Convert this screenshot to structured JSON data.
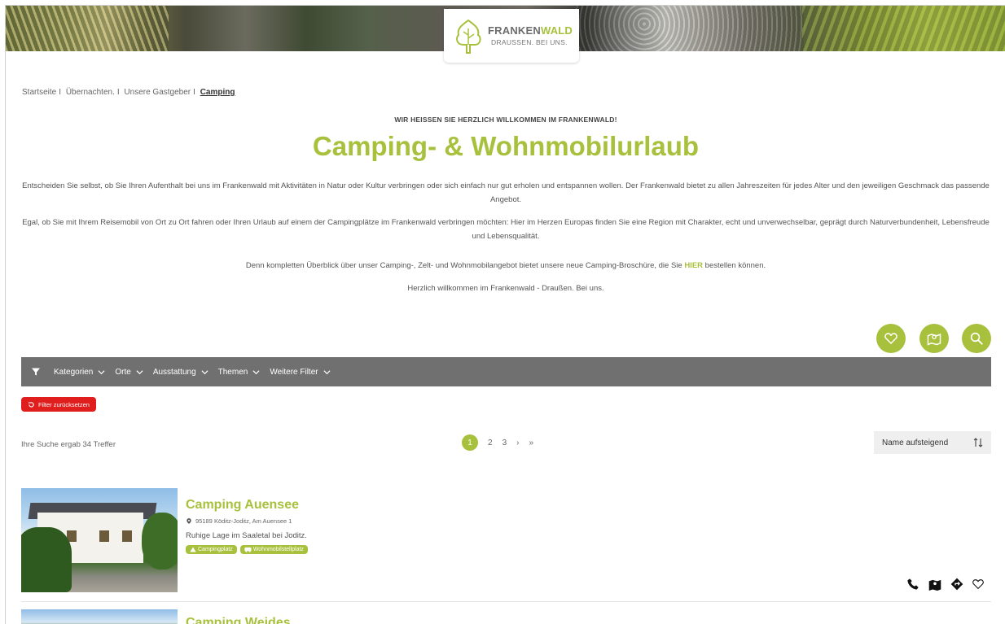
{
  "brand": {
    "name_part1": "FRANKEN",
    "name_part2": "WALD",
    "tagline": "DRAUSSEN. BEI UNS."
  },
  "breadcrumb": {
    "items": [
      "Startseite",
      "Übernachten.",
      "Unsere Gastgeber"
    ],
    "separator": "I",
    "current": "Camping"
  },
  "intro": {
    "kicker": "WIR HEISSEN SIE HERZLICH WILLKOMMEN IM FRANKENWALD!",
    "title": "Camping- & Wohnmobilurlaub",
    "p1": "Entscheiden Sie selbst, ob Sie Ihren Aufenthalt bei uns im Frankenwald mit Aktivitäten in Natur oder Kultur verbringen oder sich einfach nur gut erholen und entspannen wollen. Der Frankenwald bietet zu allen Jahreszeiten für jedes Alter und den jeweiligen Geschmack das passende Angebot.",
    "p2": "Egal, ob Sie mit Ihrem Reisemobil von Ort zu Ort fahren oder Ihren Urlaub auf einem der Campingplätze im Frankenwald verbringen möchten: Hier im Herzen Europas finden Sie eine Region mit Charakter, echt und unverwechselbar, geprägt durch Naturverbundenheit, Lebensfreude und Lebensqualität.",
    "p3_before": "Denn kompletten Überblick über unser Camping-, Zelt- und Wohnmobilangebot bietet unsere neue Camping-Broschüre, die Sie ",
    "p3_link": "HIER",
    "p3_after": " bestellen können.",
    "p4": "Herzlich willkommen im Frankenwald - Draußen. Bei uns."
  },
  "filters": {
    "items": [
      "Kategorien",
      "Orte",
      "Ausstattung",
      "Themen",
      "Weitere Filter"
    ],
    "reset_label": "Filter zurücksetzen"
  },
  "results": {
    "summary": "Ihre Suche ergab 34 Treffer",
    "pages": [
      "1",
      "2",
      "3"
    ],
    "next": "›",
    "last": "»",
    "sort_label": "Name aufsteigend"
  },
  "listings": [
    {
      "name": "Camping Auensee",
      "address": "95189 Köditz-Joditz, Am Auensee 1",
      "description": "Ruhige Lage im Saaletal bei Joditz.",
      "tags": [
        "Campingplatz",
        "Wohnmobilstellplatz"
      ]
    },
    {
      "name": "Camping Weides"
    }
  ],
  "colors": {
    "accent": "#a7c13d",
    "filterbar": "#707070",
    "reset": "#e01e1e"
  }
}
